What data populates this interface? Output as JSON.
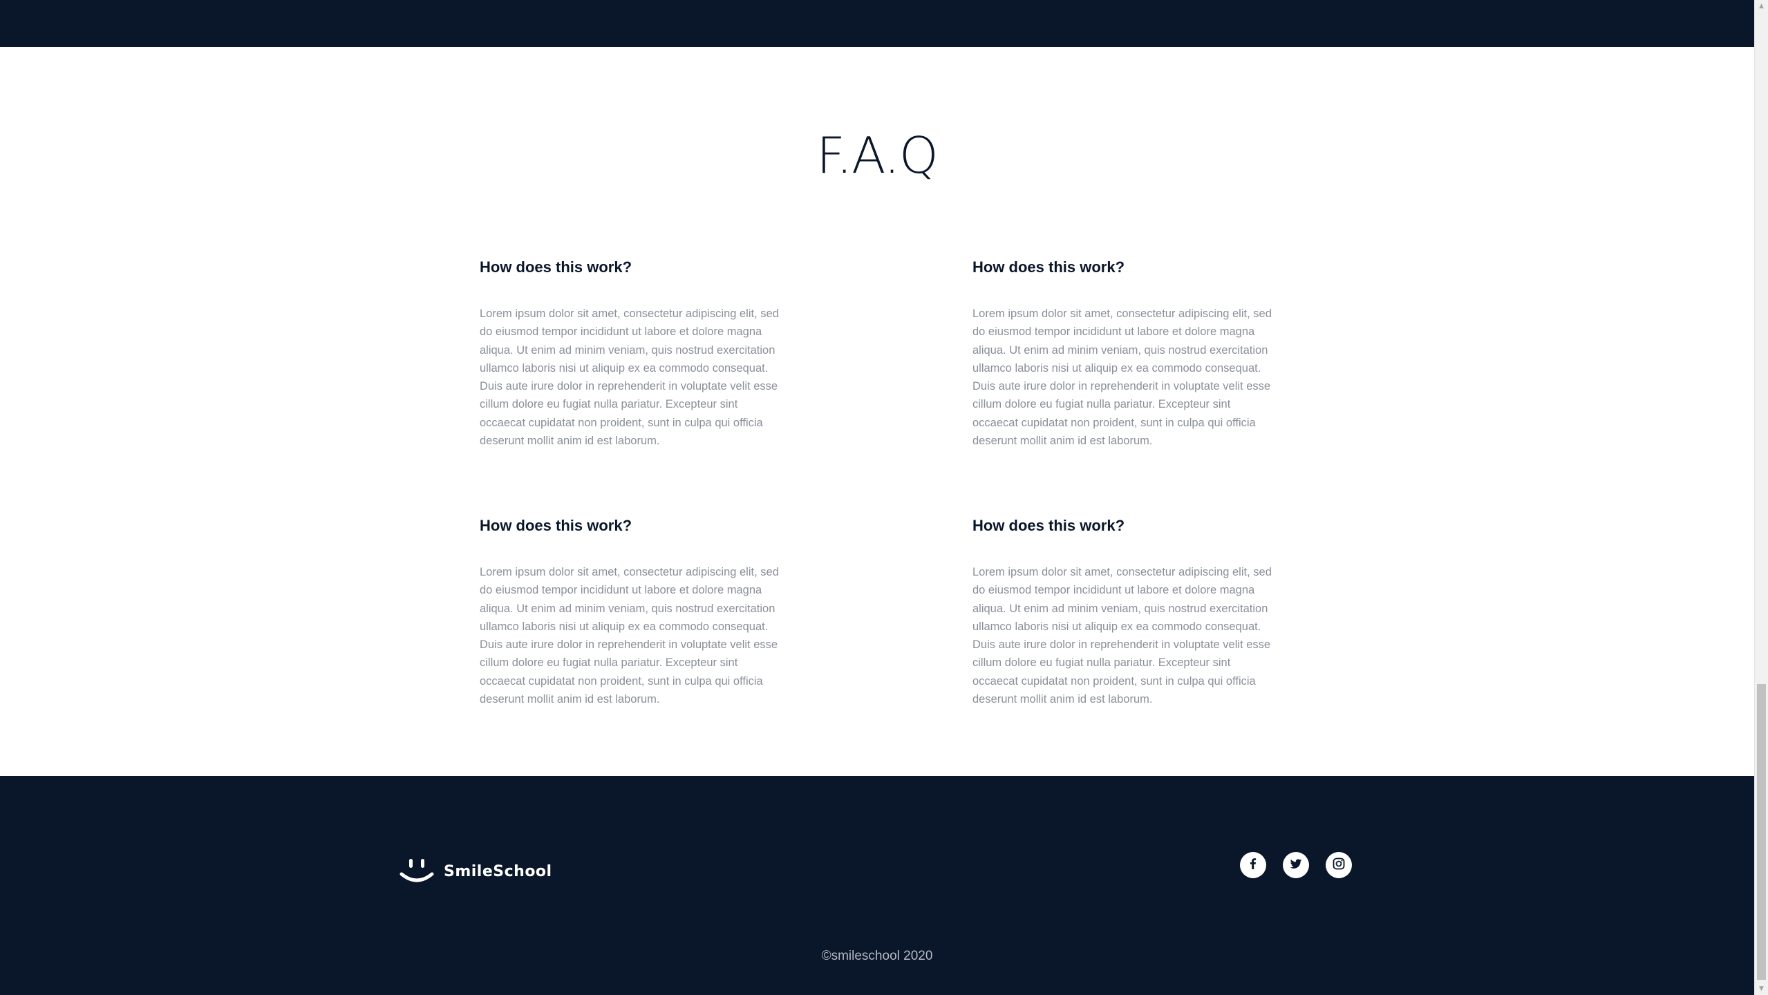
{
  "faq": {
    "title": "F.A.Q",
    "items": [
      {
        "question": "How does this work?",
        "answer": "Lorem ipsum dolor sit amet, consectetur adipiscing elit, sed do eiusmod tempor incididunt ut labore et dolore magna aliqua. Ut enim ad minim veniam, quis nostrud exercitation ullamco laboris nisi ut aliquip ex ea commodo consequat. Duis aute irure dolor in reprehenderit in voluptate velit esse cillum dolore eu fugiat nulla pariatur. Excepteur sint occaecat cupidatat non proident, sunt in culpa qui officia deserunt mollit anim id est laborum."
      },
      {
        "question": "How does this work?",
        "answer": "Lorem ipsum dolor sit amet, consectetur adipiscing elit, sed do eiusmod tempor incididunt ut labore et dolore magna aliqua. Ut enim ad minim veniam, quis nostrud exercitation ullamco laboris nisi ut aliquip ex ea commodo consequat. Duis aute irure dolor in reprehenderit in voluptate velit esse cillum dolore eu fugiat nulla pariatur. Excepteur sint occaecat cupidatat non proident, sunt in culpa qui officia deserunt mollit anim id est laborum."
      },
      {
        "question": "How does this work?",
        "answer": "Lorem ipsum dolor sit amet, consectetur adipiscing elit, sed do eiusmod tempor incididunt ut labore et dolore magna aliqua. Ut enim ad minim veniam, quis nostrud exercitation ullamco laboris nisi ut aliquip ex ea commodo consequat. Duis aute irure dolor in reprehenderit in voluptate velit esse cillum dolore eu fugiat nulla pariatur. Excepteur sint occaecat cupidatat non proident, sunt in culpa qui officia deserunt mollit anim id est laborum."
      },
      {
        "question": "How does this work?",
        "answer": "Lorem ipsum dolor sit amet, consectetur adipiscing elit, sed do eiusmod tempor incididunt ut labore et dolore magna aliqua. Ut enim ad minim veniam, quis nostrud exercitation ullamco laboris nisi ut aliquip ex ea commodo consequat. Duis aute irure dolor in reprehenderit in voluptate velit esse cillum dolore eu fugiat nulla pariatur. Excepteur sint occaecat cupidatat non proident, sunt in culpa qui officia deserunt mollit anim id est laborum."
      }
    ]
  },
  "footer": {
    "brand": "SmileSchool",
    "copyright": "©smileschool 2020",
    "social_icons": [
      "facebook-icon",
      "twitter-icon",
      "instagram-icon"
    ]
  },
  "colors": {
    "navy": "#0a1629",
    "body_text": "#8a8f99",
    "white": "#ffffff"
  }
}
